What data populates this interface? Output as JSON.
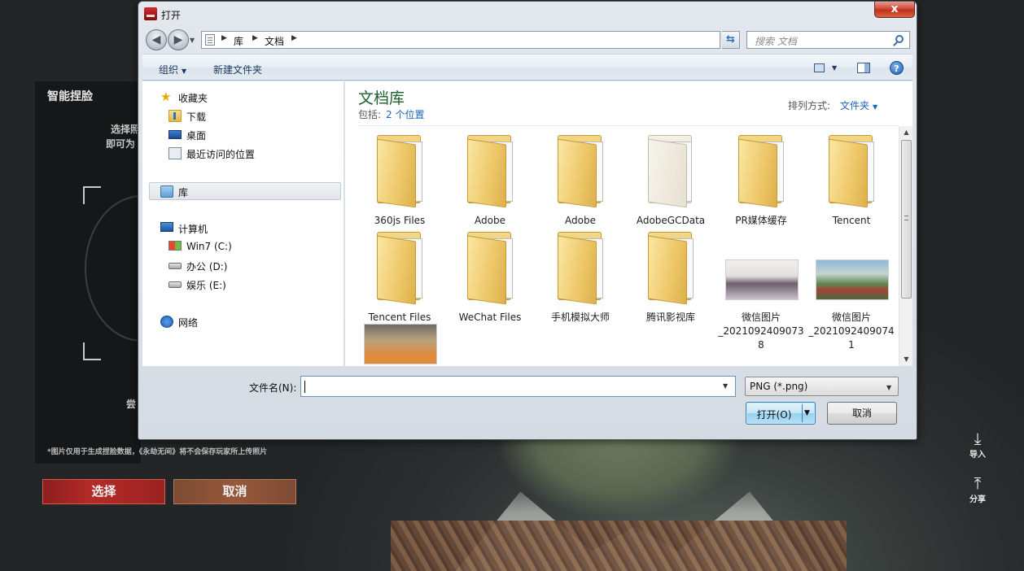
{
  "game": {
    "panel_title": "智能捏脸",
    "hint_line_1": "选择照",
    "hint_line_2": "即可为",
    "hint_line_3": "尝",
    "disclaimer": "*图片仅用于生成捏脸数据，《永劫无间》将不会保存玩家所上传照片",
    "select_label": "选择",
    "cancel_label": "取消",
    "import_label": "导入",
    "share_label": "分享"
  },
  "dialog": {
    "title": "打开",
    "close_glyph": "x",
    "breadcrumb": [
      "库",
      "文档"
    ],
    "search_placeholder": "搜索 文档",
    "toolbar": {
      "organize_label": "组织",
      "new_folder_label": "新建文件夹"
    },
    "nav": {
      "favorites": "收藏夹",
      "downloads": "下载",
      "desktop": "桌面",
      "recent": "最近访问的位置",
      "libraries": "库",
      "computer": "计算机",
      "drive_c": "Win7 (C:)",
      "drive_d": "办公 (D:)",
      "drive_e": "娱乐 (E:)",
      "network": "网络"
    },
    "library": {
      "title": "文档库",
      "includes_label": "包括:",
      "includes_link": "2 个位置",
      "sort_label": "排列方式:",
      "sort_value": "文件夹"
    },
    "items": [
      {
        "name": "360js Files",
        "type": "folder"
      },
      {
        "name": "Adobe",
        "type": "folder"
      },
      {
        "name": "Adobe",
        "type": "folder"
      },
      {
        "name": "AdobeGCData",
        "type": "folder-empty"
      },
      {
        "name": "PR媒体缓存",
        "type": "folder"
      },
      {
        "name": "Tencent",
        "type": "folder"
      },
      {
        "name": "Tencent Files",
        "type": "folder"
      },
      {
        "name": "WeChat Files",
        "type": "folder"
      },
      {
        "name": "手机模拟大师",
        "type": "folder"
      },
      {
        "name": "腾讯影视库",
        "type": "folder"
      },
      {
        "name": "微信图片_2021092409073 8",
        "type": "image"
      },
      {
        "name": "微信图片_2021092409074 1",
        "type": "image"
      }
    ],
    "filename_label": "文件名(N):",
    "filename_value": "",
    "filetype_value": "PNG (*.png)",
    "open_label": "打开(O)",
    "cancel_label": "取消"
  }
}
